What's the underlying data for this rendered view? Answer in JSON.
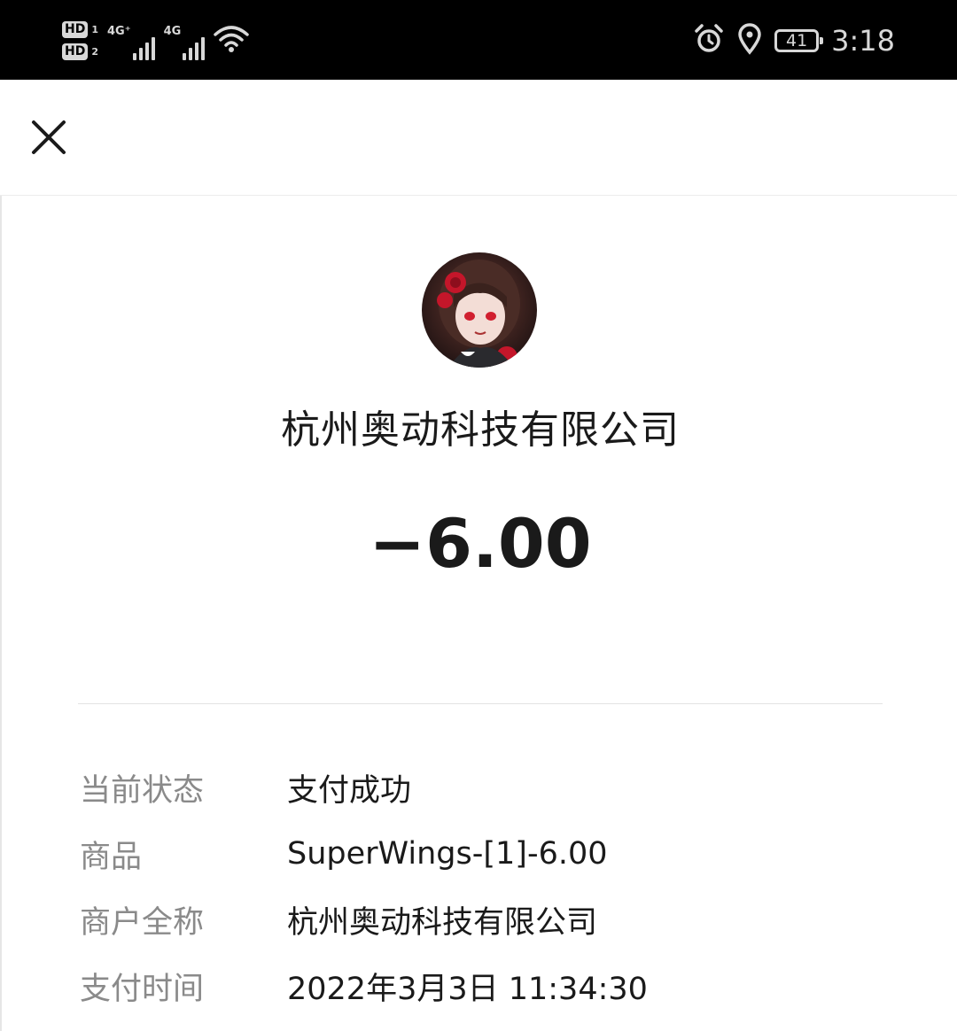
{
  "status_bar": {
    "sim1_badge": "HD",
    "sim1_index": "1",
    "sim2_badge": "HD",
    "sim2_index": "2",
    "network1": "4G⁺",
    "network2": "4G",
    "battery": "41",
    "time": "3:18",
    "icons": [
      "alarm-icon",
      "location-icon",
      "wifi-icon",
      "battery-icon"
    ]
  },
  "header": {
    "close_icon": "close-icon"
  },
  "merchant": {
    "name": "杭州奥动科技有限公司"
  },
  "transaction": {
    "amount": "−6.00"
  },
  "details": [
    {
      "label": "当前状态",
      "value": "支付成功"
    },
    {
      "label": "商品",
      "value": "SuperWings-[1]-6.00"
    },
    {
      "label": "商户全称",
      "value": "杭州奥动科技有限公司"
    },
    {
      "label": "支付时间",
      "value": "2022年3月3日 11:34:30"
    }
  ],
  "colors": {
    "status_bar_bg": "#000000",
    "label_gray": "#8a8a8a",
    "text_dark": "#1a1a1a",
    "divider": "#e3e3e3"
  }
}
